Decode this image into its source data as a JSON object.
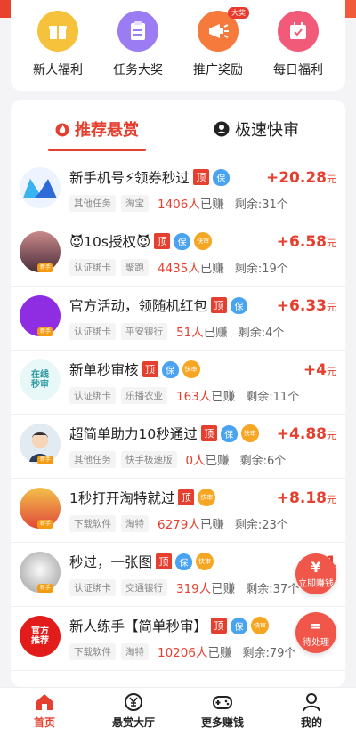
{
  "quick_actions": [
    {
      "label": "新人福利",
      "icon": "gift-icon",
      "color": "#f7c23b"
    },
    {
      "label": "任务大奖",
      "icon": "clipboard-icon",
      "color": "#9b7cf2"
    },
    {
      "label": "推广奖励",
      "icon": "megaphone-icon",
      "color": "#f67a3c",
      "badge": "大奖"
    },
    {
      "label": "每日福利",
      "icon": "calendar-icon",
      "color": "#f25a7a"
    }
  ],
  "tabs": {
    "recommended": "推荐悬赏",
    "fast_review": "极速快审"
  },
  "tasks": [
    {
      "title": "新手机号⚡领券秒过",
      "tags": [
        "ding",
        "bao"
      ],
      "chips": [
        "其他任务",
        "淘宝"
      ],
      "earned_count": "1406人",
      "earned_suffix": "已赚",
      "remain": "剩余:31个",
      "reward": "+20.28",
      "unit": "元",
      "avatar_color": "#2f6bd8",
      "avatar_text": ""
    },
    {
      "title": "😈10s授权😈",
      "tags": [
        "ding",
        "bao",
        "kuai"
      ],
      "chips": [
        "认证绑卡",
        "聚跑"
      ],
      "earned_count": "4435人",
      "earned_suffix": "已赚",
      "remain": "剩余:19个",
      "reward": "+6.58",
      "unit": "元",
      "avatar_color": "#7a4a5a",
      "avatar_text": ""
    },
    {
      "title": "官方活动，领随机红包",
      "tags": [
        "ding",
        "bao"
      ],
      "chips": [
        "认证绑卡",
        "平安银行"
      ],
      "earned_count": "51人",
      "earned_suffix": "已赚",
      "remain": "剩余:4个",
      "reward": "+6.33",
      "unit": "元",
      "avatar_color": "#8e2de2",
      "avatar_text": ""
    },
    {
      "title": "新单秒审核",
      "tags": [
        "ding",
        "bao",
        "kuai"
      ],
      "chips": [
        "认证绑卡",
        "乐播农业"
      ],
      "earned_count": "163人",
      "earned_suffix": "已赚",
      "remain": "剩余:11个",
      "reward": "+4",
      "unit": "元",
      "avatar_color": "#6cc7c9",
      "avatar_text": "在线\n秒审"
    },
    {
      "title": "超简单助力10秒通过",
      "tags": [
        "ding",
        "bao",
        "kuai"
      ],
      "chips": [
        "其他任务",
        "快手极速版"
      ],
      "earned_count": "0人",
      "earned_suffix": "已赚",
      "remain": "剩余:6个",
      "reward": "+4.88",
      "unit": "元",
      "avatar_color": "#cfd8e3",
      "avatar_text": ""
    },
    {
      "title": "1秒打开淘特就过",
      "tags": [
        "ding",
        "kuai"
      ],
      "chips": [
        "下载软件",
        "淘特"
      ],
      "earned_count": "6279人",
      "earned_suffix": "已赚",
      "remain": "剩余:23个",
      "reward": "+8.18",
      "unit": "元",
      "avatar_color": "#e0483a",
      "avatar_text": ""
    },
    {
      "title": "秒过，一张图",
      "tags": [
        "ding",
        "bao",
        "kuai"
      ],
      "chips": [
        "认证绑卡",
        "交通银行"
      ],
      "earned_count": "319人",
      "earned_suffix": "已赚",
      "remain": "剩余:37个",
      "reward": "+1",
      "unit": "",
      "avatar_color": "#c9c9c9",
      "avatar_text": ""
    },
    {
      "title": "新人练手【简单秒审】",
      "tags": [
        "ding",
        "bao",
        "kuai"
      ],
      "chips": [
        "下载软件",
        "淘特"
      ],
      "earned_count": "10206人",
      "earned_suffix": "已赚",
      "remain": "剩余:79个",
      "reward": "+",
      "unit": "",
      "avatar_color": "#e21b1b",
      "avatar_text": "官方\n推荐"
    }
  ],
  "tag_labels": {
    "ding": "顶",
    "bao": "保",
    "kuai": "快审"
  },
  "avatar_tag": "新手",
  "floating": {
    "earn_label": "立即赚钱",
    "earn_symbol": "¥",
    "pending_label": "待处理",
    "pending_symbol": "="
  },
  "bottom_nav": [
    {
      "label": "首页",
      "icon": "home-icon",
      "active": true
    },
    {
      "label": "悬赏大厅",
      "icon": "yen-coin-icon",
      "active": false
    },
    {
      "label": "更多赚钱",
      "icon": "gamepad-icon",
      "active": false
    },
    {
      "label": "我的",
      "icon": "user-icon",
      "active": false
    }
  ],
  "colors": {
    "accent": "#e5402f",
    "info": "#4aa3f0",
    "warn": "#f5a623"
  }
}
